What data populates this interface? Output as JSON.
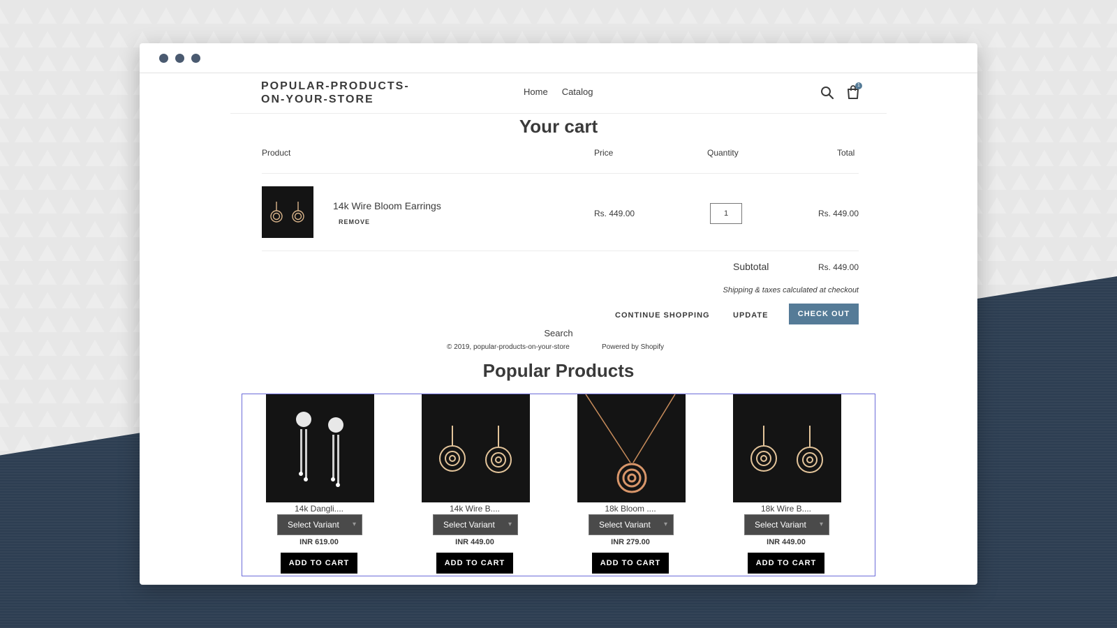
{
  "store": {
    "name": "POPULAR-PRODUCTS-ON-YOUR-STORE"
  },
  "nav": {
    "home": "Home",
    "catalog": "Catalog"
  },
  "icons": {
    "search": "search-icon",
    "cart": "shopping-bag-icon",
    "cart_count": "1"
  },
  "cart": {
    "title": "Your cart",
    "headers": {
      "product": "Product",
      "price": "Price",
      "quantity": "Quantity",
      "total": "Total"
    },
    "item": {
      "name": "14k Wire Bloom Earrings",
      "remove": "REMOVE",
      "price": "Rs. 449.00",
      "quantity": "1",
      "total": "Rs. 449.00"
    },
    "subtotal_label": "Subtotal",
    "subtotal_value": "Rs. 449.00",
    "shipping_note": "Shipping & taxes calculated at checkout",
    "continue": "CONTINUE SHOPPING",
    "update": "UPDATE",
    "checkout": "CHECK OUT"
  },
  "footer": {
    "search": "Search",
    "copyright": "© 2019, popular-products-on-your-store",
    "powered": "Powered by Shopify"
  },
  "popular": {
    "title": "Popular Products",
    "products": [
      {
        "name": "14k Dangli....",
        "variant": "Select Variant",
        "price": "INR 619.00",
        "button": "ADD TO CART",
        "image": "dangling-earrings"
      },
      {
        "name": "14k Wire B....",
        "variant": "Select Variant",
        "price": "INR 449.00",
        "button": "ADD TO CART",
        "image": "rose-earrings"
      },
      {
        "name": "18k Bloom ....",
        "variant": "Select Variant",
        "price": "INR 279.00",
        "button": "ADD TO CART",
        "image": "rose-pendant"
      },
      {
        "name": "18k Wire B....",
        "variant": "Select Variant",
        "price": "INR 449.00",
        "button": "ADD TO CART",
        "image": "rose-earrings"
      }
    ]
  },
  "colors": {
    "accent": "#557b97",
    "selection_border": "#6b6bd9",
    "dark_bg": "#2d3e52"
  }
}
